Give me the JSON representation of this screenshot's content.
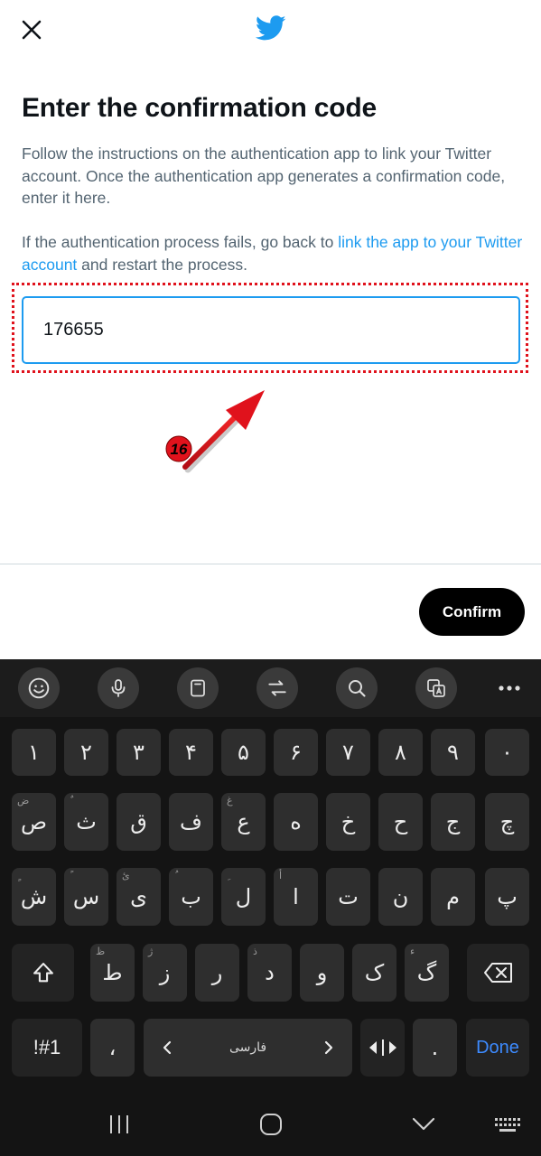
{
  "header": {
    "close_icon": "close-icon",
    "logo_icon": "twitter-bird-icon"
  },
  "content": {
    "title": "Enter the confirmation code",
    "para1": "Follow the instructions on the authentication app to link your Twitter account. Once the authentication app generates a confirmation code, enter it here.",
    "para2_before": "If the authentication process fails, go back to ",
    "para2_link": "link the app to your Twitter account",
    "para2_after": " and restart the process.",
    "code_value": "176655"
  },
  "annotation": {
    "step_number": "16",
    "color": "#e0121c"
  },
  "footer": {
    "confirm_label": "Confirm"
  },
  "keyboard": {
    "toolbar_icons": [
      "emoji-icon",
      "microphone-icon",
      "clipboard-icon",
      "translate-icon",
      "search-icon",
      "image-translate-icon",
      "more-icon"
    ],
    "row_digits": [
      "١",
      "٢",
      "٣",
      "۴",
      "۵",
      "۶",
      "٧",
      "٨",
      "٩",
      "٠"
    ],
    "row2": [
      {
        "main": "ص",
        "sub": "ض"
      },
      {
        "main": "ث",
        "sub": "ٌ"
      },
      {
        "main": "ق",
        "sub": ""
      },
      {
        "main": "ف",
        "sub": ""
      },
      {
        "main": "ع",
        "sub": "غ"
      },
      {
        "main": "ه",
        "sub": ""
      },
      {
        "main": "خ",
        "sub": ""
      },
      {
        "main": "ح",
        "sub": ""
      },
      {
        "main": "ج",
        "sub": ""
      },
      {
        "main": "چ",
        "sub": ""
      }
    ],
    "row3": [
      {
        "main": "ش",
        "sub": "ٍ"
      },
      {
        "main": "س",
        "sub": "ً"
      },
      {
        "main": "ی",
        "sub": "ئ"
      },
      {
        "main": "ب",
        "sub": "ُ"
      },
      {
        "main": "ل",
        "sub": "ِ"
      },
      {
        "main": "ا",
        "sub": "أ"
      },
      {
        "main": "ت",
        "sub": ""
      },
      {
        "main": "ن",
        "sub": ""
      },
      {
        "main": "م",
        "sub": ""
      },
      {
        "main": "پ",
        "sub": ""
      }
    ],
    "row4": [
      {
        "main": "ط",
        "sub": "ظ"
      },
      {
        "main": "ز",
        "sub": "ژ"
      },
      {
        "main": "ر",
        "sub": ""
      },
      {
        "main": "د",
        "sub": "ذ"
      },
      {
        "main": "و",
        "sub": ""
      },
      {
        "main": "ک",
        "sub": ""
      },
      {
        "main": "گ",
        "sub": "ء"
      }
    ],
    "sym_label": "!#1",
    "comma": "،",
    "space_label": "فارسی",
    "period": ".",
    "done_label": "Done",
    "accent_color": "#3d8bff"
  },
  "brand": {
    "twitter_blue": "#1d9bf0"
  }
}
